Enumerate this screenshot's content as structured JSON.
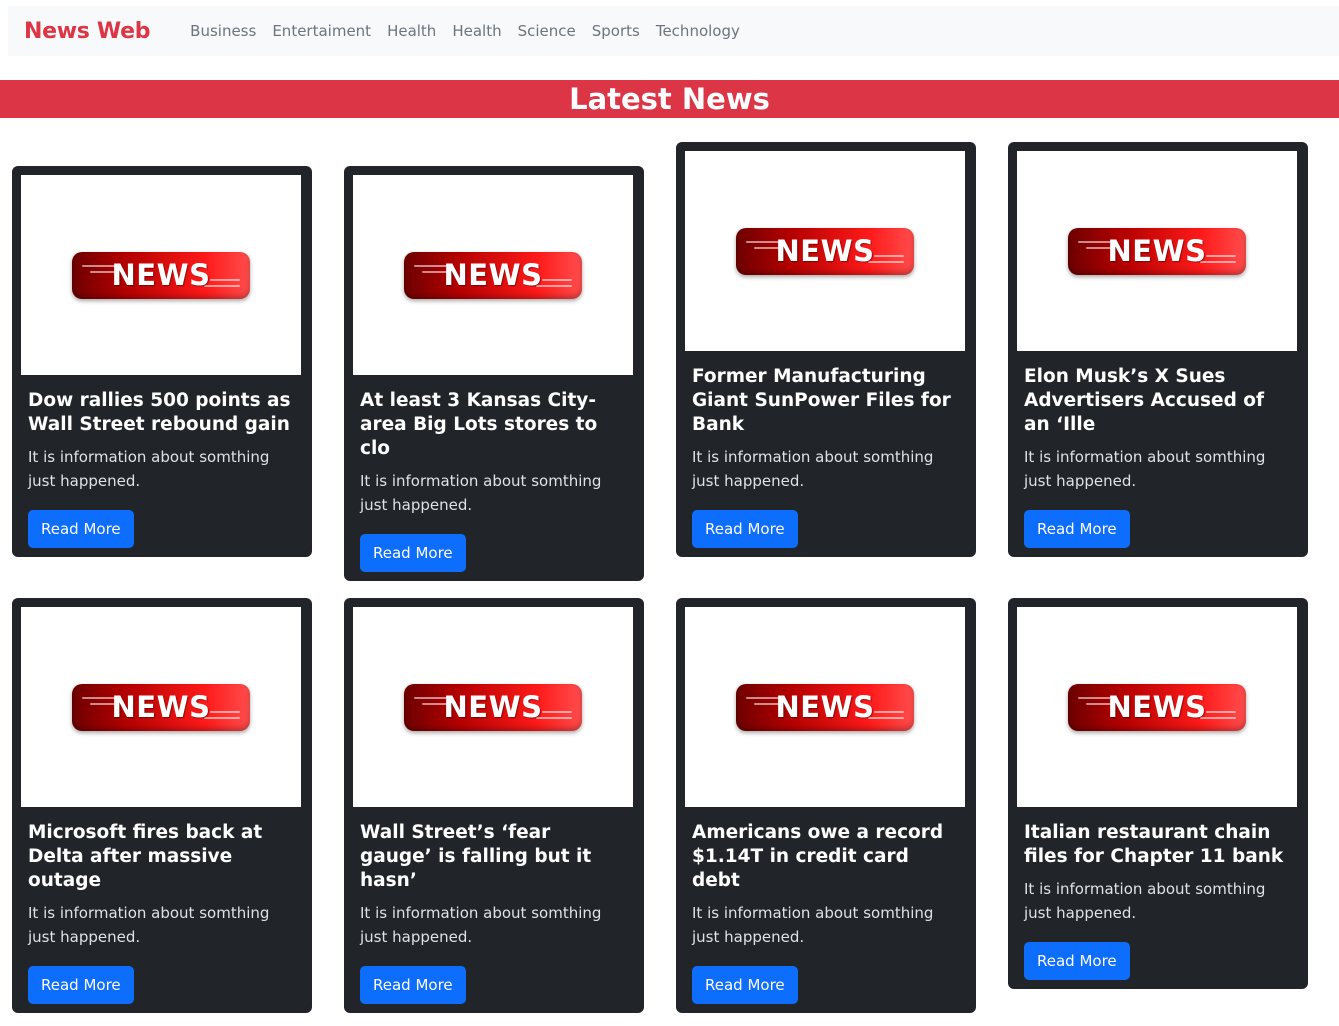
{
  "navbar": {
    "brand": "News Web",
    "links": [
      "Business",
      "Entertaiment",
      "Health",
      "Health",
      "Science",
      "Sports",
      "Technology"
    ]
  },
  "banner": {
    "title": "Latest News"
  },
  "image_text": "NEWS",
  "cards": [
    {
      "title": "Dow rallies 500 points as Wall Street rebound gain",
      "text": "It is information about somthing just happened.",
      "button": "Read More"
    },
    {
      "title": "At least 3 Kansas City-area Big Lots stores to clo",
      "text": "It is information about somthing just happened.",
      "button": "Read More"
    },
    {
      "title": "Former Manufacturing Giant SunPower Files for Bank",
      "text": "It is information about somthing just happened.",
      "button": "Read More"
    },
    {
      "title": "Elon Musk’s X Sues Advertisers Accused of an ‘Ille",
      "text": "It is information about somthing just happened.",
      "button": "Read More"
    },
    {
      "title": "Microsoft fires back at Delta after massive outage",
      "text": "It is information about somthing just happened.",
      "button": "Read More"
    },
    {
      "title": "Wall Street’s ‘fear gauge’ is falling but it hasn’",
      "text": "It is information about somthing just happened.",
      "button": "Read More"
    },
    {
      "title": "Americans owe a record $1.14T in credit card debt",
      "text": "It is information about somthing just happened.",
      "button": "Read More"
    },
    {
      "title": "Italian restaurant chain files for Chapter 11 bank",
      "text": "It is information about somthing just happened.",
      "button": "Read More"
    }
  ],
  "colors": {
    "brand": "#dc3545",
    "banner": "#dc3545",
    "card_bg": "#212529",
    "button": "#0d6efd",
    "navbar_bg": "#f8f9fa"
  }
}
